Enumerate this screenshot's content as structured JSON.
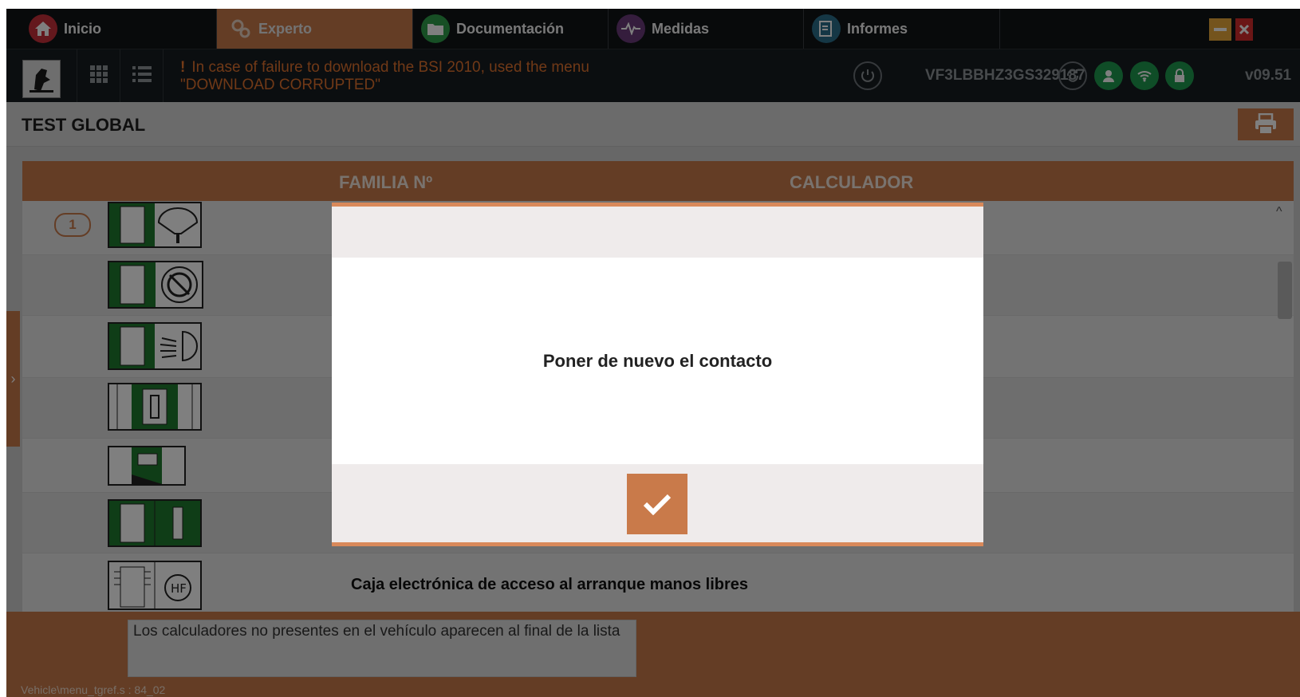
{
  "tabs": [
    {
      "label": "Inicio",
      "icon": "home-icon",
      "color": "#c8303a"
    },
    {
      "label": "Experto",
      "icon": "gears-icon",
      "color": "#c97a4a"
    },
    {
      "label": "Documentación",
      "icon": "folder-icon",
      "color": "#2e9e4a"
    },
    {
      "label": "Medidas",
      "icon": "waveform-icon",
      "color": "#6a3a7a"
    },
    {
      "label": "Informes",
      "icon": "report-icon",
      "color": "#2a6f8a"
    }
  ],
  "window": {
    "minimize_color": "#e8a93a",
    "close_color": "#d62c2c"
  },
  "toolbar": {
    "warning_line1": "In case of failure to download the BSI 2010, used the menu",
    "warning_line2": "\"DOWNLOAD CORRUPTED\"",
    "vin": "VF3LBBHZ3GS329187",
    "version": "v09.51",
    "status_color": "#1f9a4f",
    "warning_color": "#e0722e"
  },
  "page": {
    "title": "TEST GLOBAL"
  },
  "table": {
    "headers": {
      "familia": "FAMILIA Nº",
      "calculador": "CALCULADOR"
    },
    "first_row_number": "1",
    "last_row_text": "Caja electrónica de acceso al arranque manos libres"
  },
  "footer": {
    "message": "Los calculadores no presentes en el vehículo aparecen al final de la lista",
    "path": "Vehicle\\menu_tgref.s : 84_02"
  },
  "modal": {
    "message": "Poner de nuevo el contacto"
  },
  "colors": {
    "accent": "#c97a4a",
    "dark": "#111417",
    "ecu_green": "#1f7a2e"
  }
}
